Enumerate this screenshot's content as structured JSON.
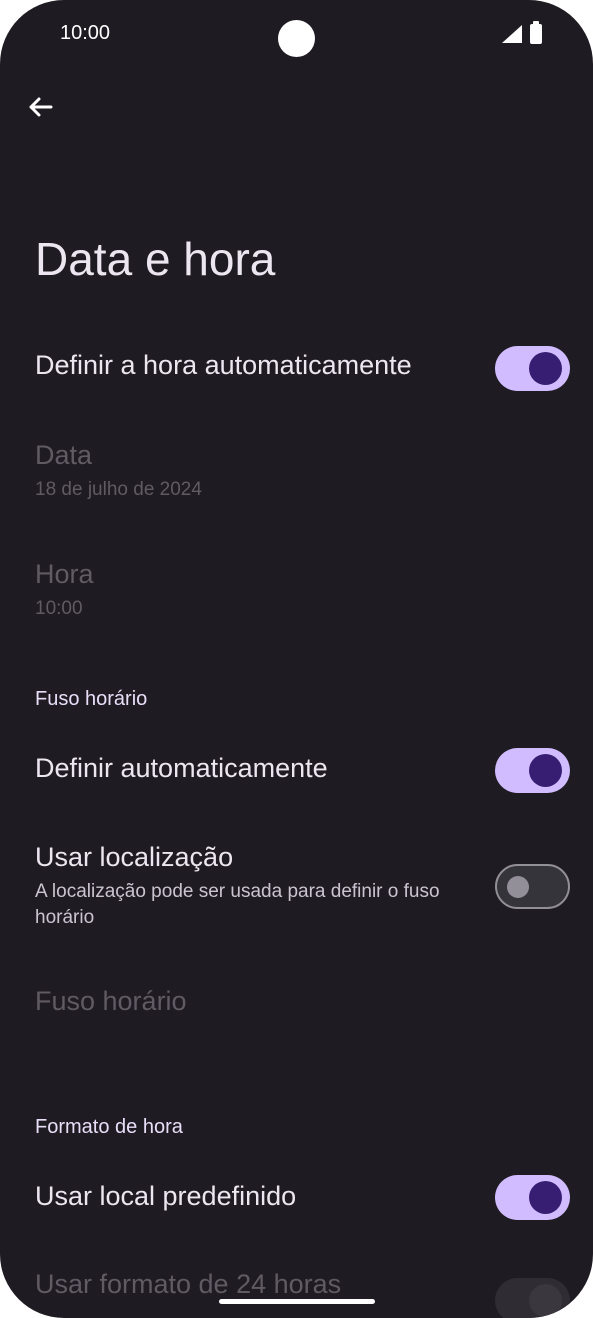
{
  "status_bar": {
    "time": "10:00"
  },
  "page": {
    "title": "Data e hora"
  },
  "settings": {
    "auto_time": {
      "label": "Definir a hora automaticamente",
      "enabled": true
    },
    "date": {
      "label": "Data",
      "value": "18 de julho de 2024"
    },
    "hour": {
      "label": "Hora",
      "value": "10:00"
    },
    "tz_section": {
      "header": "Fuso horário"
    },
    "auto_tz": {
      "label": "Definir automaticamente",
      "enabled": true
    },
    "use_location": {
      "label": "Usar localização",
      "summary": "A localização pode ser usada para definir o fuso horário",
      "enabled": false
    },
    "timezone": {
      "label": "Fuso horário"
    },
    "format_section": {
      "header": "Formato de hora"
    },
    "locale_default": {
      "label": "Usar local predefinido",
      "enabled": true
    },
    "use_24h": {
      "label": "Usar formato de 24 horas"
    }
  },
  "colors": {
    "background": "#1f1b22",
    "accent": "#d0bcff",
    "accent_dark": "#381e72"
  }
}
